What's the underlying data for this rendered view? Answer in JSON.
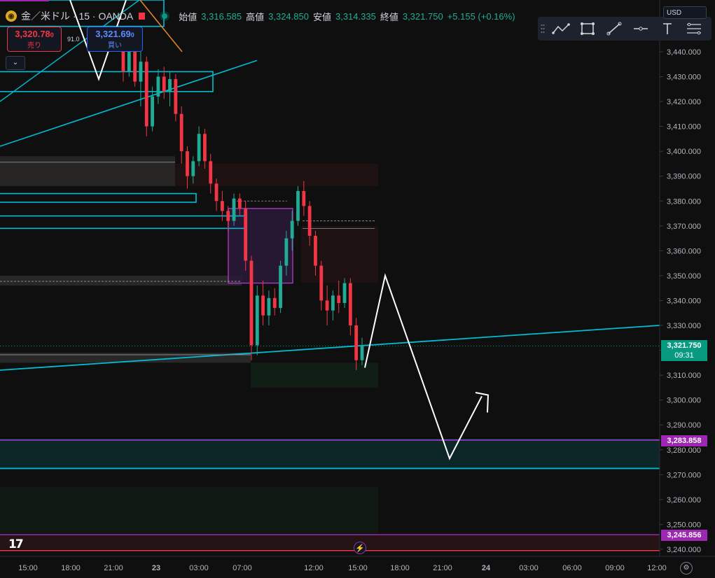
{
  "header": {
    "symbol_title": "金／米ドル · 15 · OANDA",
    "symbol_icon": "gold-coin-icon",
    "ohlc": [
      {
        "label": "始値",
        "value": "3,316.585"
      },
      {
        "label": "高値",
        "value": "3,324.850"
      },
      {
        "label": "安値",
        "value": "3,314.335"
      },
      {
        "label": "終値",
        "value": "3,321.750"
      }
    ],
    "change": "+5.155 (+0.16%)"
  },
  "trade": {
    "sell_price": "3,320.78",
    "sell_price_small": "0",
    "sell_label": "売り",
    "buy_price": "3,321.69",
    "buy_price_small": "0",
    "buy_label": "買い",
    "spread": "91.0"
  },
  "toolbar": {
    "tools": [
      "path-tool-icon",
      "rectangle-tool-icon",
      "trend-line-tool-icon",
      "horizontal-ray-tool-icon",
      "text-tool-icon",
      "fib-tool-icon"
    ]
  },
  "currency": "USD",
  "price_tags": {
    "last_price": "3,321.750",
    "countdown": "09:31",
    "level_upper": "3,283.858",
    "level_lower": "3,245.856"
  },
  "colors": {
    "up": "#22ab94",
    "down": "#f23645",
    "cyan": "#00bcd4",
    "purple": "#9c27b0",
    "last_price": "#089981"
  },
  "chart_data": {
    "type": "candlestick",
    "symbol": "金／米ドル",
    "interval": "15",
    "ylim": [
      3237,
      3452
    ],
    "y_ticks": [
      3440,
      3430,
      3420,
      3410,
      3400,
      3390,
      3380,
      3370,
      3360,
      3350,
      3340,
      3330,
      3320,
      3310,
      3300,
      3290,
      3280,
      3270,
      3260,
      3250,
      3240
    ],
    "y_tick_labels": [
      "3,440.000",
      "3,430.000",
      "3,420.000",
      "3,410.000",
      "3,400.000",
      "3,390.000",
      "3,380.000",
      "3,370.000",
      "3,360.000",
      "3,350.000",
      "3,340.000",
      "3,330.000",
      "3,320.000",
      "3,310.000",
      "3,300.000",
      "3,290.000",
      "3,280.000",
      "3,270.000",
      "3,260.000",
      "3,250.000",
      "3,240.000"
    ],
    "x_ticks": [
      "15:00",
      "18:00",
      "21:00",
      "23",
      "03:00",
      "07:00",
      "12:00",
      "15:00",
      "18:00",
      "21:00",
      "24",
      "03:00",
      "06:00",
      "09:00",
      "12:00"
    ],
    "candles": [
      {
        "o": 3440,
        "h": 3444,
        "l": 3428,
        "c": 3432
      },
      {
        "o": 3432,
        "h": 3446,
        "l": 3430,
        "c": 3442
      },
      {
        "o": 3442,
        "h": 3445,
        "l": 3426,
        "c": 3428
      },
      {
        "o": 3428,
        "h": 3440,
        "l": 3418,
        "c": 3436
      },
      {
        "o": 3436,
        "h": 3438,
        "l": 3406,
        "c": 3410
      },
      {
        "o": 3410,
        "h": 3426,
        "l": 3408,
        "c": 3422
      },
      {
        "o": 3422,
        "h": 3433,
        "l": 3419,
        "c": 3430
      },
      {
        "o": 3430,
        "h": 3434,
        "l": 3421,
        "c": 3424
      },
      {
        "o": 3424,
        "h": 3432,
        "l": 3418,
        "c": 3429
      },
      {
        "o": 3429,
        "h": 3431,
        "l": 3412,
        "c": 3415
      },
      {
        "o": 3415,
        "h": 3418,
        "l": 3395,
        "c": 3400
      },
      {
        "o": 3400,
        "h": 3402,
        "l": 3385,
        "c": 3390
      },
      {
        "o": 3390,
        "h": 3398,
        "l": 3387,
        "c": 3396
      },
      {
        "o": 3396,
        "h": 3410,
        "l": 3394,
        "c": 3407
      },
      {
        "o": 3407,
        "h": 3409,
        "l": 3393,
        "c": 3396
      },
      {
        "o": 3396,
        "h": 3399,
        "l": 3383,
        "c": 3387
      },
      {
        "o": 3387,
        "h": 3389,
        "l": 3376,
        "c": 3380
      },
      {
        "o": 3380,
        "h": 3384,
        "l": 3372,
        "c": 3376
      },
      {
        "o": 3376,
        "h": 3378,
        "l": 3368,
        "c": 3372
      },
      {
        "o": 3372,
        "h": 3383,
        "l": 3370,
        "c": 3381
      },
      {
        "o": 3381,
        "h": 3383,
        "l": 3374,
        "c": 3377
      },
      {
        "o": 3377,
        "h": 3380,
        "l": 3352,
        "c": 3356
      },
      {
        "o": 3356,
        "h": 3358,
        "l": 3316,
        "c": 3322
      },
      {
        "o": 3322,
        "h": 3346,
        "l": 3318,
        "c": 3342
      },
      {
        "o": 3342,
        "h": 3348,
        "l": 3330,
        "c": 3334
      },
      {
        "o": 3334,
        "h": 3344,
        "l": 3330,
        "c": 3341
      },
      {
        "o": 3341,
        "h": 3345,
        "l": 3334,
        "c": 3337
      },
      {
        "o": 3337,
        "h": 3356,
        "l": 3335,
        "c": 3354
      },
      {
        "o": 3354,
        "h": 3368,
        "l": 3350,
        "c": 3365
      },
      {
        "o": 3365,
        "h": 3376,
        "l": 3360,
        "c": 3372
      },
      {
        "o": 3372,
        "h": 3386,
        "l": 3370,
        "c": 3384
      },
      {
        "o": 3384,
        "h": 3388,
        "l": 3374,
        "c": 3378
      },
      {
        "o": 3378,
        "h": 3380,
        "l": 3362,
        "c": 3366
      },
      {
        "o": 3366,
        "h": 3368,
        "l": 3350,
        "c": 3354
      },
      {
        "o": 3354,
        "h": 3356,
        "l": 3336,
        "c": 3340
      },
      {
        "o": 3340,
        "h": 3346,
        "l": 3330,
        "c": 3336
      },
      {
        "o": 3336,
        "h": 3344,
        "l": 3332,
        "c": 3342
      },
      {
        "o": 3342,
        "h": 3348,
        "l": 3335,
        "c": 3339
      },
      {
        "o": 3339,
        "h": 3349,
        "l": 3337,
        "c": 3347
      },
      {
        "o": 3347,
        "h": 3349,
        "l": 3326,
        "c": 3330
      },
      {
        "o": 3330,
        "h": 3333,
        "l": 3312,
        "c": 3316
      },
      {
        "o": 3316,
        "h": 3325,
        "l": 3314,
        "c": 3321.75
      }
    ],
    "horizontal_levels": [
      {
        "price": 3283.858,
        "color": "purple",
        "label": "3,283.858"
      },
      {
        "price": 3245.856,
        "color": "purple",
        "label": "3,245.856"
      }
    ],
    "last_price": 3321.75
  }
}
